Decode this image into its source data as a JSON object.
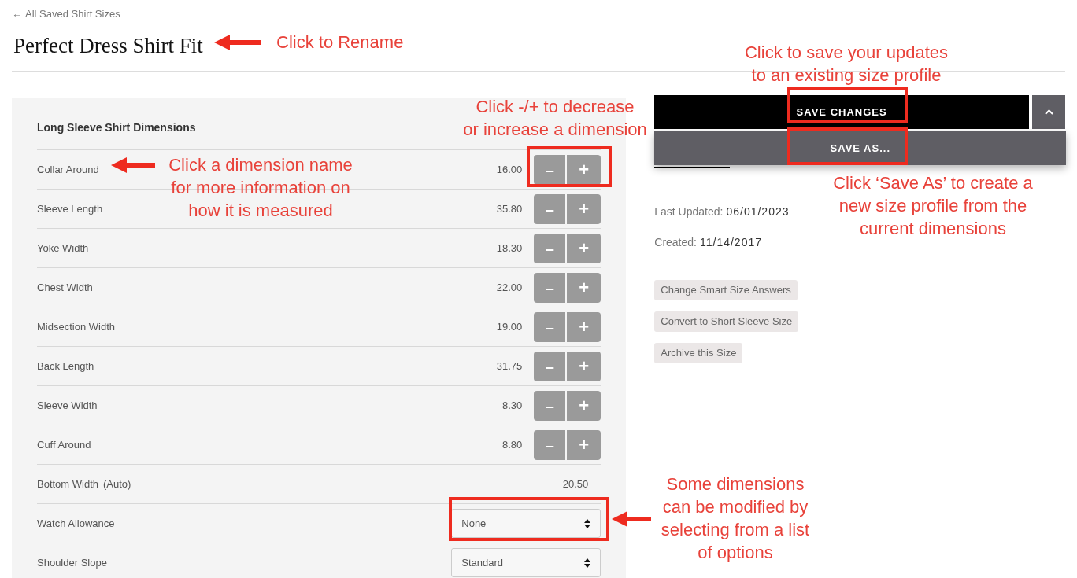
{
  "back_link": {
    "arrow": "←",
    "label": "All Saved Shirt Sizes"
  },
  "title": "Perfect Dress Shirt Fit",
  "dimensions": {
    "heading": "Long Sleeve Shirt Dimensions",
    "rows": [
      {
        "kind": "stepper",
        "label": "Collar Around",
        "value": "16.00",
        "minus": "–",
        "plus": "+"
      },
      {
        "kind": "stepper",
        "label": "Sleeve Length",
        "value": "35.80",
        "minus": "–",
        "plus": "+"
      },
      {
        "kind": "stepper",
        "label": "Yoke Width",
        "value": "18.30",
        "minus": "–",
        "plus": "+"
      },
      {
        "kind": "stepper",
        "label": "Chest Width",
        "value": "22.00",
        "minus": "–",
        "plus": "+"
      },
      {
        "kind": "stepper",
        "label": "Midsection Width",
        "value": "19.00",
        "minus": "–",
        "plus": "+"
      },
      {
        "kind": "stepper",
        "label": "Back Length",
        "value": "31.75",
        "minus": "–",
        "plus": "+"
      },
      {
        "kind": "stepper",
        "label": "Sleeve Width",
        "value": "8.30",
        "minus": "–",
        "plus": "+"
      },
      {
        "kind": "stepper",
        "label": "Cuff Around",
        "value": "8.80",
        "minus": "–",
        "plus": "+"
      },
      {
        "kind": "auto",
        "label": "Bottom Width",
        "note": "(Auto)",
        "value": "20.50"
      },
      {
        "kind": "select",
        "label": "Watch Allowance",
        "value": "None"
      },
      {
        "kind": "select",
        "label": "Shoulder Slope",
        "value": "Standard"
      }
    ]
  },
  "save_button": "SAVE CHANGES",
  "save_menu": {
    "expanded": true,
    "items": [
      "SAVE AS..."
    ]
  },
  "info": {
    "last_updated_label": "Last Updated:",
    "last_updated": "06/01/2023",
    "created_label": "Created:",
    "created": "11/14/2017"
  },
  "actions": [
    "Change Smart Size Answers",
    "Convert to Short Sleeve Size",
    "Archive this Size"
  ],
  "annotations": [
    "Click to Rename",
    "Click to save your updates\nto an existing size profile",
    "Click -/+ to decrease\nor increase a dimension",
    "Click a dimension name\nfor more information on\nhow it is measured",
    "Click ‘Save As’ to create a\nnew size profile from the\ncurrent dimensions",
    "Some dimensions\ncan be modified by\nselecting from a list\nof options"
  ]
}
